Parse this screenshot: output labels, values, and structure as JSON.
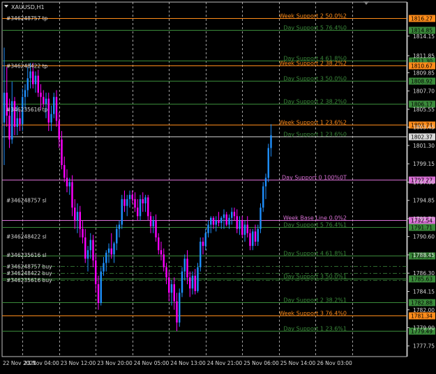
{
  "window": {
    "symbol_title": "XAUUSD,H1"
  },
  "colors": {
    "background": "#000000",
    "frame": "#c0c0c0",
    "grid": "#c8c8c8",
    "bull": "#1e90ff",
    "bear": "#ff00ff",
    "week_support": "#ff8c1a",
    "day_support": "#3a8a3a",
    "key_level": "#da70d6",
    "ask": "#c8c8c8",
    "trade_level": "#2e6b2e",
    "axis_text": "#d8d8d8"
  },
  "chart_data": {
    "type": "candlestick",
    "title": "XAUUSD,H1",
    "ylim": [
      1776.5,
      1817.0
    ],
    "y_ticks": [
      "1814.15",
      "1811.85",
      "1809.85",
      "1807.70",
      "1805.55",
      "1803.45",
      "1801.30",
      "1799.15",
      "1797.00",
      "1794.85",
      "1792.70",
      "1790.60",
      "1788.45",
      "1786.30",
      "1784.15",
      "1782.00",
      "1779.90",
      "1777.75"
    ],
    "x_ticks": [
      "22 Nov 2021",
      "23 Nov 04:00",
      "23 Nov 12:00",
      "23 Nov 20:00",
      "24 Nov 05:00",
      "24 Nov 13:00",
      "24 Nov 21:00",
      "25 Nov 06:00",
      "25 Nov 14:00",
      "26 Nov 03:00"
    ],
    "vertical_grid_candles": [
      7,
      21,
      35,
      49,
      63,
      77,
      91,
      105,
      119,
      133
    ],
    "ohlc": [
      [
        1804.0,
        1812.8,
        1799.0,
        1807.5
      ],
      [
        1807.5,
        1810.5,
        1803.5,
        1804.8
      ],
      [
        1804.8,
        1806.8,
        1801.0,
        1802.0
      ],
      [
        1802.0,
        1808.8,
        1801.5,
        1806.5
      ],
      [
        1806.5,
        1807.0,
        1802.5,
        1803.5
      ],
      [
        1803.5,
        1806.0,
        1802.5,
        1804.5
      ],
      [
        1804.5,
        1805.5,
        1803.0,
        1803.8
      ],
      [
        1803.8,
        1808.0,
        1803.0,
        1807.0
      ],
      [
        1807.0,
        1808.5,
        1805.5,
        1807.8
      ],
      [
        1807.8,
        1810.5,
        1807.0,
        1809.2
      ],
      [
        1809.2,
        1811.0,
        1808.0,
        1810.0
      ],
      [
        1810.0,
        1811.0,
        1808.0,
        1808.5
      ],
      [
        1808.5,
        1810.0,
        1807.5,
        1809.5
      ],
      [
        1809.5,
        1810.2,
        1807.0,
        1807.5
      ],
      [
        1807.5,
        1808.5,
        1805.5,
        1807.0
      ],
      [
        1807.0,
        1807.8,
        1805.8,
        1806.2
      ],
      [
        1806.2,
        1807.5,
        1804.5,
        1806.8
      ],
      [
        1806.8,
        1807.5,
        1803.0,
        1804.0
      ],
      [
        1804.0,
        1806.0,
        1803.0,
        1805.0
      ],
      [
        1805.0,
        1807.5,
        1804.5,
        1807.0
      ],
      [
        1807.0,
        1807.8,
        1803.5,
        1804.2
      ],
      [
        1804.2,
        1805.2,
        1801.0,
        1802.0
      ],
      [
        1802.0,
        1803.0,
        1798.5,
        1799.0
      ],
      [
        1799.0,
        1800.0,
        1797.0,
        1797.5
      ],
      [
        1797.5,
        1798.5,
        1795.8,
        1796.5
      ],
      [
        1796.5,
        1797.5,
        1795.5,
        1797.0
      ],
      [
        1797.0,
        1797.8,
        1793.0,
        1794.0
      ],
      [
        1794.0,
        1795.0,
        1791.5,
        1792.5
      ],
      [
        1792.5,
        1794.5,
        1791.0,
        1793.5
      ],
      [
        1793.5,
        1794.2,
        1790.5,
        1791.5
      ],
      [
        1791.5,
        1792.5,
        1789.8,
        1790.5
      ],
      [
        1790.5,
        1791.5,
        1787.5,
        1788.0
      ],
      [
        1788.0,
        1789.5,
        1786.5,
        1789.0
      ],
      [
        1789.0,
        1791.0,
        1788.0,
        1790.2
      ],
      [
        1790.2,
        1790.8,
        1787.0,
        1787.8
      ],
      [
        1787.8,
        1788.5,
        1784.0,
        1785.0
      ],
      [
        1785.0,
        1786.0,
        1782.0,
        1782.8
      ],
      [
        1782.8,
        1787.0,
        1782.5,
        1786.5
      ],
      [
        1786.5,
        1788.2,
        1786.0,
        1787.5
      ],
      [
        1787.5,
        1789.0,
        1786.5,
        1788.7
      ],
      [
        1788.7,
        1789.8,
        1787.5,
        1789.2
      ],
      [
        1789.2,
        1791.0,
        1788.0,
        1788.5
      ],
      [
        1788.5,
        1790.0,
        1787.5,
        1789.8
      ],
      [
        1789.8,
        1792.0,
        1789.0,
        1791.5
      ],
      [
        1791.5,
        1792.5,
        1790.5,
        1792.0
      ],
      [
        1792.0,
        1795.5,
        1791.5,
        1795.0
      ],
      [
        1795.0,
        1796.0,
        1793.5,
        1794.2
      ],
      [
        1794.2,
        1795.5,
        1793.0,
        1795.0
      ],
      [
        1795.0,
        1796.0,
        1794.0,
        1795.5
      ],
      [
        1795.5,
        1796.0,
        1794.5,
        1795.0
      ],
      [
        1795.0,
        1795.8,
        1793.5,
        1794.0
      ],
      [
        1794.0,
        1795.0,
        1792.5,
        1793.0
      ],
      [
        1793.0,
        1795.5,
        1792.5,
        1795.0
      ],
      [
        1795.0,
        1795.8,
        1793.5,
        1794.5
      ],
      [
        1794.5,
        1795.5,
        1793.5,
        1795.2
      ],
      [
        1795.2,
        1795.5,
        1792.5,
        1793.0
      ],
      [
        1793.0,
        1793.5,
        1791.0,
        1791.8
      ],
      [
        1791.8,
        1793.0,
        1791.0,
        1792.5
      ],
      [
        1792.5,
        1793.2,
        1790.0,
        1790.5
      ],
      [
        1790.5,
        1791.0,
        1788.5,
        1789.0
      ],
      [
        1789.0,
        1790.0,
        1787.8,
        1788.5
      ],
      [
        1788.5,
        1789.2,
        1786.5,
        1787.0
      ],
      [
        1787.0,
        1787.5,
        1785.0,
        1785.8
      ],
      [
        1785.8,
        1786.5,
        1783.0,
        1784.0
      ],
      [
        1784.0,
        1785.5,
        1782.5,
        1785.0
      ],
      [
        1785.0,
        1785.8,
        1782.0,
        1783.0
      ],
      [
        1783.0,
        1784.0,
        1779.5,
        1780.5
      ],
      [
        1780.5,
        1784.5,
        1780.0,
        1784.0
      ],
      [
        1784.0,
        1787.0,
        1783.5,
        1786.5
      ],
      [
        1786.5,
        1788.5,
        1785.5,
        1788.0
      ],
      [
        1788.0,
        1789.0,
        1785.0,
        1785.8
      ],
      [
        1785.8,
        1786.5,
        1783.5,
        1784.5
      ],
      [
        1784.5,
        1786.5,
        1783.8,
        1786.0
      ],
      [
        1786.0,
        1786.8,
        1783.8,
        1784.2
      ],
      [
        1784.2,
        1787.5,
        1784.0,
        1787.0
      ],
      [
        1787.0,
        1790.5,
        1786.5,
        1790.0
      ],
      [
        1790.0,
        1790.5,
        1788.5,
        1789.5
      ],
      [
        1789.5,
        1791.5,
        1789.0,
        1791.0
      ],
      [
        1791.0,
        1792.5,
        1790.5,
        1792.0
      ],
      [
        1792.0,
        1793.0,
        1791.0,
        1792.8
      ],
      [
        1792.8,
        1793.0,
        1791.5,
        1792.0
      ],
      [
        1792.0,
        1793.0,
        1791.2,
        1792.5
      ],
      [
        1792.5,
        1793.5,
        1791.8,
        1792.2
      ],
      [
        1792.2,
        1793.0,
        1791.5,
        1792.8
      ],
      [
        1792.8,
        1793.8,
        1791.5,
        1793.2
      ],
      [
        1793.2,
        1793.5,
        1791.8,
        1792.0
      ],
      [
        1792.0,
        1793.2,
        1791.5,
        1792.8
      ],
      [
        1792.8,
        1794.0,
        1792.0,
        1793.5
      ],
      [
        1793.5,
        1794.0,
        1792.5,
        1793.0
      ],
      [
        1793.0,
        1793.8,
        1791.0,
        1791.5
      ],
      [
        1791.5,
        1793.0,
        1790.8,
        1792.5
      ],
      [
        1792.5,
        1793.0,
        1790.5,
        1790.8
      ],
      [
        1790.8,
        1792.5,
        1790.0,
        1792.0
      ],
      [
        1792.0,
        1793.0,
        1790.5,
        1791.0
      ],
      [
        1791.0,
        1791.5,
        1789.0,
        1789.5
      ],
      [
        1789.5,
        1791.5,
        1789.0,
        1791.2
      ],
      [
        1791.2,
        1792.0,
        1789.5,
        1790.0
      ],
      [
        1790.0,
        1792.0,
        1789.5,
        1791.5
      ],
      [
        1791.5,
        1794.5,
        1791.0,
        1794.0
      ],
      [
        1794.0,
        1797.0,
        1793.5,
        1796.5
      ],
      [
        1796.5,
        1798.0,
        1795.0,
        1797.5
      ],
      [
        1797.5,
        1801.5,
        1797.0,
        1801.0
      ],
      [
        1801.0,
        1803.8,
        1800.0,
        1802.5
      ]
    ],
    "levels": [
      {
        "name": "Week Support 2 50.0%2",
        "price": 1816.27,
        "kind": "week",
        "price_tag": "1816.27"
      },
      {
        "name": "Day Support 5 76.4%0",
        "price": 1814.85,
        "kind": "day",
        "price_tag": "1814.85"
      },
      {
        "name": "Day Support 4 61.8%0",
        "price": 1811.3,
        "kind": "day",
        "price_tag": "1811.30"
      },
      {
        "name": "Week Support 2 38.2%2",
        "price": 1810.67,
        "kind": "week",
        "price_tag": "1810.67"
      },
      {
        "name": "Day Support 3 50.0%0",
        "price": 1808.92,
        "kind": "day",
        "price_tag": "1808.92"
      },
      {
        "name": "Day Support 2 38.2%0",
        "price": 1806.17,
        "kind": "day",
        "price_tag": "1806.17"
      },
      {
        "name": "Week Support 1 23.6%2",
        "price": 1803.74,
        "kind": "week",
        "price_tag": "1803.74"
      },
      {
        "name": "Day Support 1 23.6%0",
        "price": 1802.37,
        "kind": "ask",
        "price_tag": "1802.37"
      },
      {
        "name": "Day Support 0 100%0T",
        "price": 1797.27,
        "kind": "key",
        "price_tag": "1797.27"
      },
      {
        "name": "Week Base Line 0.0%2",
        "price": 1792.54,
        "kind": "key",
        "price_tag": "1792.54"
      },
      {
        "name": "Day Support 5 76.4%1",
        "price": 1791.71,
        "kind": "day",
        "price_tag": "1791.71"
      },
      {
        "name": "Day Support 4 61.8%1",
        "price": 1788.38,
        "kind": "day",
        "price_tag": "1788.38"
      },
      {
        "name": "Day Support 3 50.0%1",
        "price": 1785.63,
        "kind": "day",
        "price_tag": "1785.63"
      },
      {
        "name": "Day Support 2 38.2%1",
        "price": 1782.88,
        "kind": "day",
        "price_tag": "1782.88"
      },
      {
        "name": "Week Support 3 76.4%0",
        "price": 1781.34,
        "kind": "week",
        "price_tag": "1781.34"
      },
      {
        "name": "Day Support 1 23.6%1",
        "price": 1779.49,
        "kind": "day",
        "price_tag": "1779.49"
      }
    ],
    "trade_labels": [
      {
        "text": "#346248757 tp",
        "price": 1816.27
      },
      {
        "text": "#346248422 tp",
        "price": 1810.67
      },
      {
        "text": "#346235616 tp",
        "price": 1805.55
      },
      {
        "text": "#346248757 sl",
        "price": 1794.85
      },
      {
        "text": "#346248422 sl",
        "price": 1790.6
      },
      {
        "text": "#346235616 sl",
        "price": 1788.45
      },
      {
        "text": "#346248757 buy",
        "price": 1787.1
      },
      {
        "text": "#346248422 buy",
        "price": 1786.3
      },
      {
        "text": "#346235616 buy",
        "price": 1785.5
      }
    ],
    "buy_lines": [
      1787.1,
      1786.3,
      1785.5
    ]
  }
}
